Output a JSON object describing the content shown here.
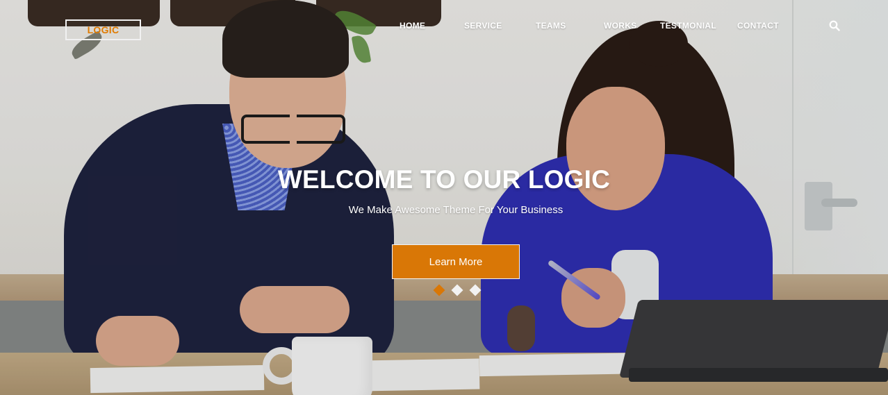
{
  "brand": {
    "logo_text": "LOGIC"
  },
  "nav": {
    "items": [
      {
        "label": "HOME"
      },
      {
        "label": "SERVICE"
      },
      {
        "label": "TEAMS"
      },
      {
        "label": "WORKS"
      },
      {
        "label": "TESTMONIAL"
      },
      {
        "label": "CONTACT"
      }
    ],
    "search_icon": "search-icon"
  },
  "hero": {
    "title": "WELCOME TO OUR LOGIC",
    "subtitle": "We Make Awesome Theme For Your Business",
    "cta_label": "Learn More",
    "slider": {
      "slide_count": 3,
      "active_index": 0
    }
  },
  "colors": {
    "accent": "#d97706",
    "logo_text": "#e07b00",
    "nav_text": "#ffffff",
    "dot_active": "#d97706",
    "dot_inactive": "#f2f2f2"
  }
}
